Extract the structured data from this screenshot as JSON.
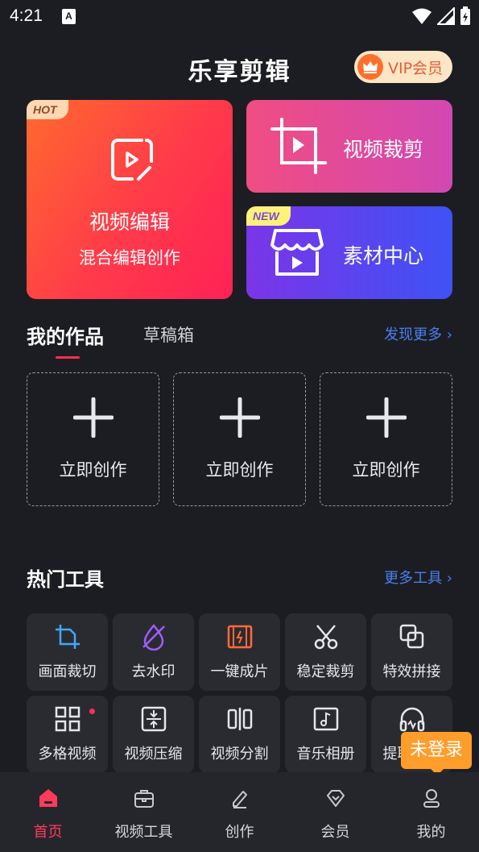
{
  "status": {
    "time": "4:21",
    "notif_letter": "A"
  },
  "header": {
    "title": "乐享剪辑",
    "vip_label": "VIP会员"
  },
  "cards": {
    "main": {
      "tag": "HOT",
      "title": "视频编辑",
      "subtitle": "混合编辑创作"
    },
    "crop": {
      "title": "视频裁剪"
    },
    "material": {
      "tag": "NEW",
      "title": "素材中心"
    }
  },
  "works": {
    "tab_active": "我的作品",
    "tab_draft": "草稿箱",
    "more": "发现更多 ›",
    "create_label": "立即创作"
  },
  "tools_section": {
    "title": "热门工具",
    "more": "更多工具 ›"
  },
  "tools": [
    {
      "label": "画面裁切",
      "icon": "crop-icon"
    },
    {
      "label": "去水印",
      "icon": "watermark-remove-icon"
    },
    {
      "label": "一键成片",
      "icon": "film-icon"
    },
    {
      "label": "稳定裁剪",
      "icon": "scissors-icon"
    },
    {
      "label": "特效拼接",
      "icon": "layers-icon"
    },
    {
      "label": "多格视频",
      "icon": "grid-icon"
    },
    {
      "label": "视频压缩",
      "icon": "compress-icon"
    },
    {
      "label": "视频分割",
      "icon": "split-icon"
    },
    {
      "label": "音乐相册",
      "icon": "music-album-icon"
    },
    {
      "label": "提取音频",
      "icon": "headphones-icon"
    }
  ],
  "tooltip": {
    "text": "未登录"
  },
  "nav": [
    {
      "label": "首页",
      "icon": "home-icon"
    },
    {
      "label": "视频工具",
      "icon": "toolbox-icon"
    },
    {
      "label": "创作",
      "icon": "pen-icon"
    },
    {
      "label": "会员",
      "icon": "diamond-icon"
    },
    {
      "label": "我的",
      "icon": "user-icon"
    }
  ],
  "colors": {
    "accent": "#ff2e56",
    "link": "#4a7ff0",
    "tooltip": "#ff9d2b"
  }
}
